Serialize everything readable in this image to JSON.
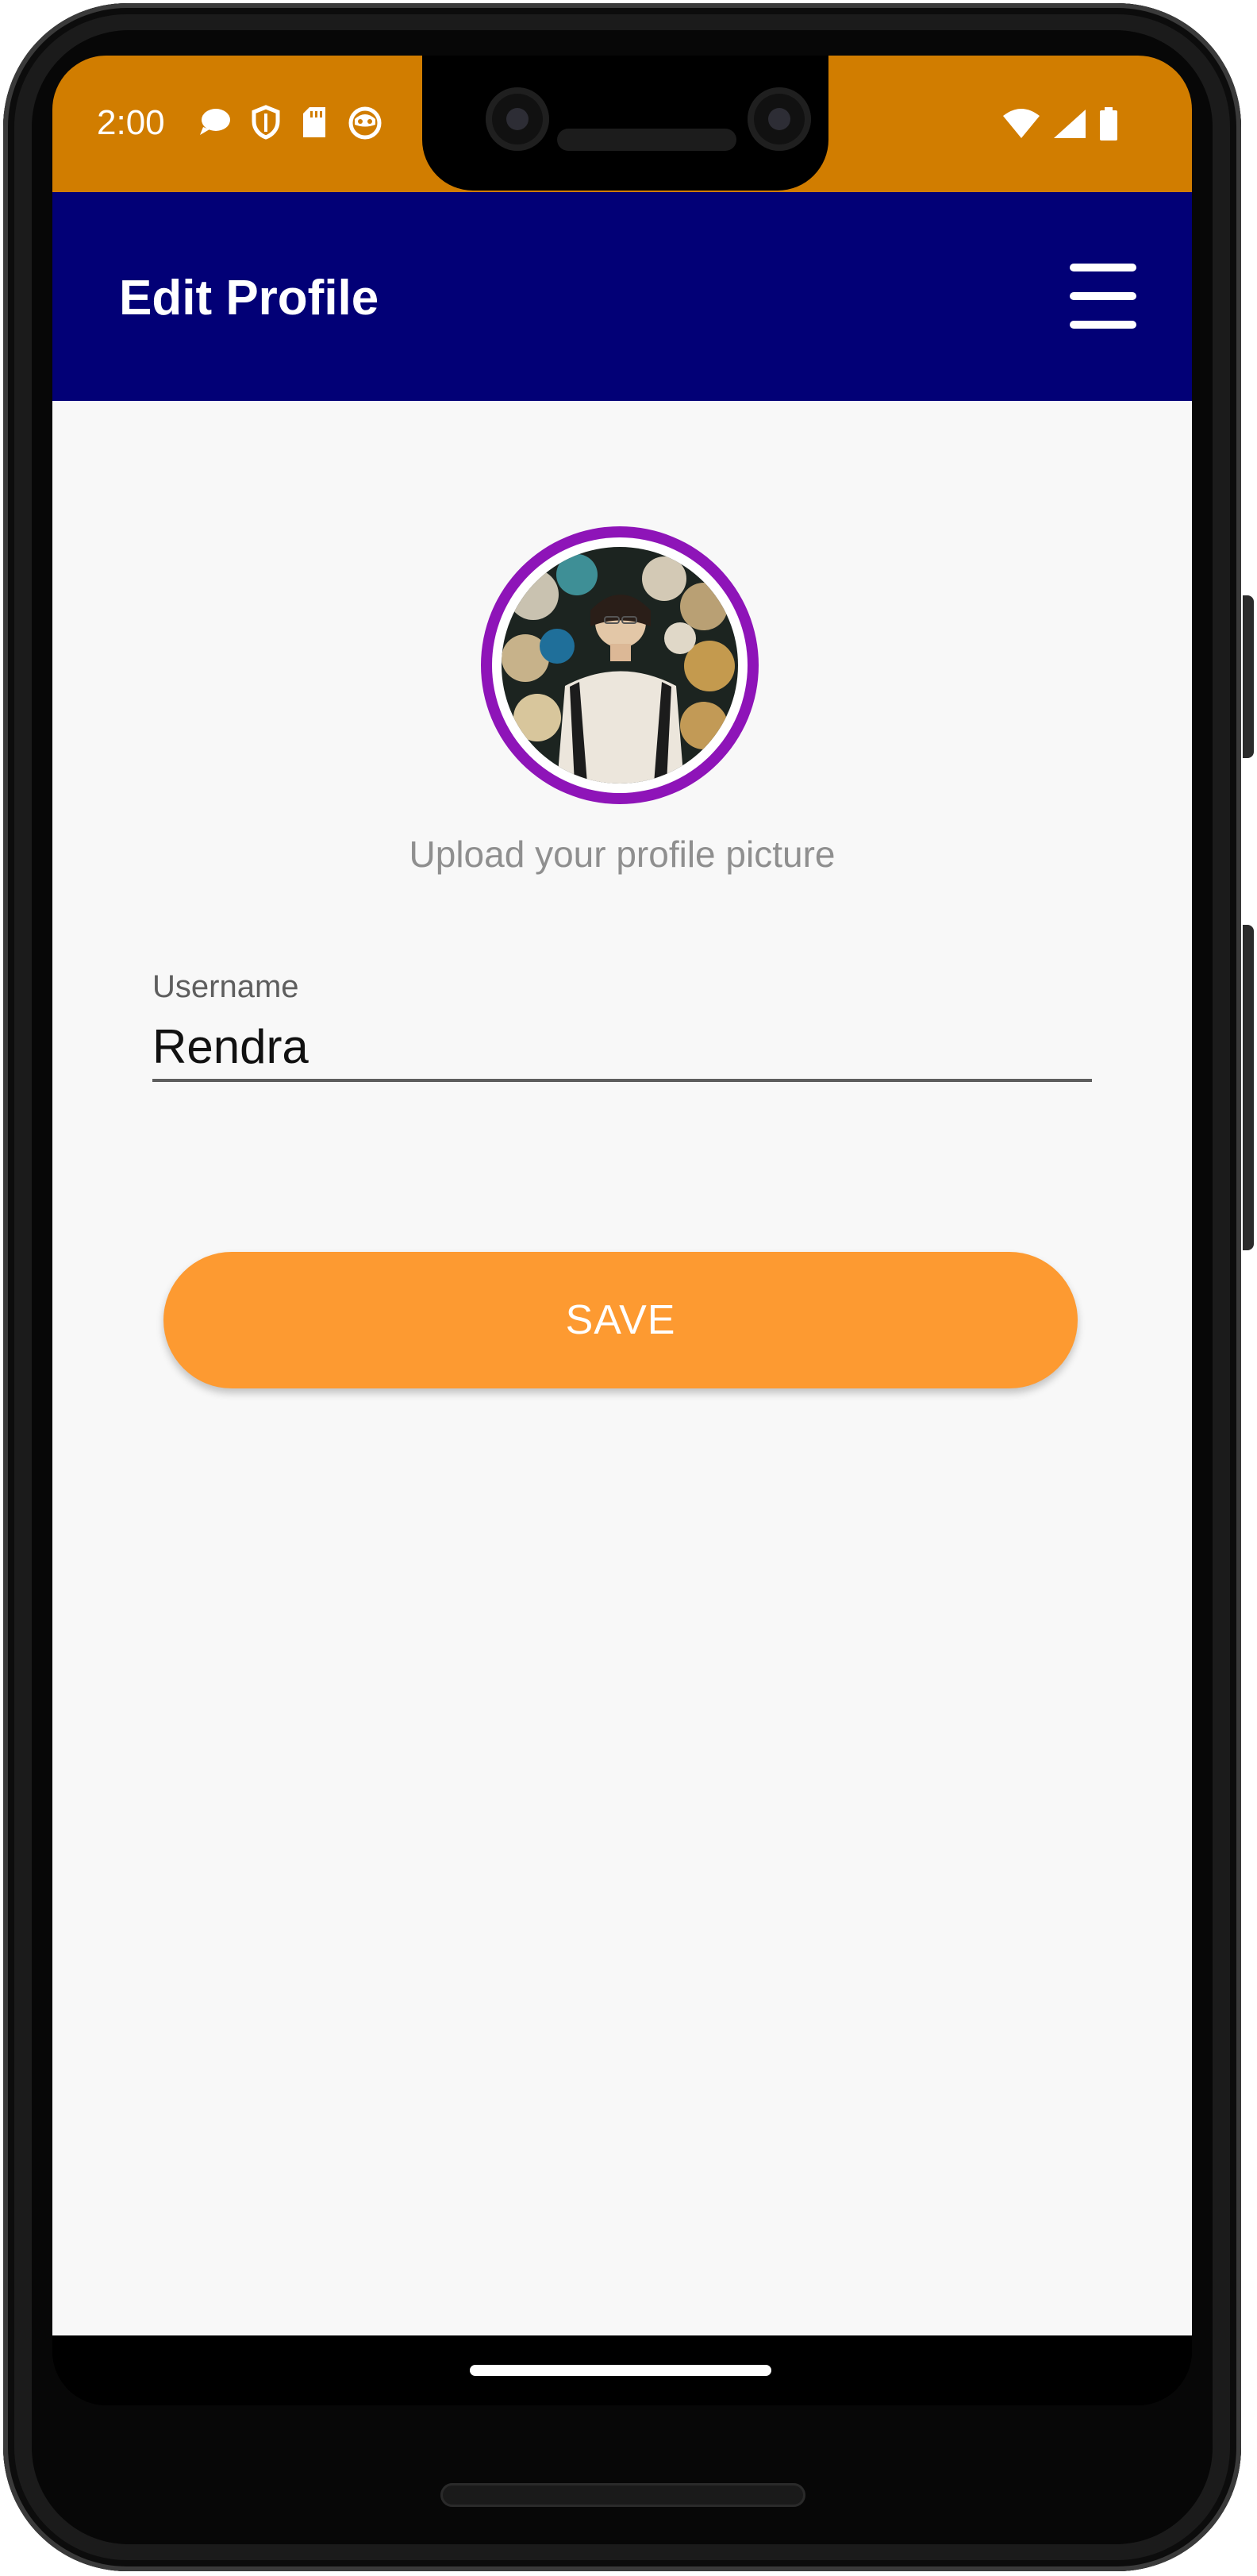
{
  "status_bar": {
    "time": "2:00",
    "background_color": "#d17d00",
    "left_icons": [
      "chat-bubble-icon",
      "shield-icon",
      "sd-card-icon",
      "cat-face-icon"
    ],
    "right_icons": [
      "wifi-icon",
      "cellular-signal-icon",
      "battery-icon"
    ]
  },
  "app_bar": {
    "title": "Edit Profile",
    "background_color": "#020076",
    "menu_icon": "hamburger-menu-icon"
  },
  "profile": {
    "avatar_icon": "profile-photo",
    "avatar_ring_color": "#8e14b8",
    "upload_caption": "Upload your profile picture"
  },
  "form": {
    "username_label": "Username",
    "username_value": "Rendra"
  },
  "actions": {
    "save_label": "SAVE",
    "save_color": "#fd9a31"
  }
}
